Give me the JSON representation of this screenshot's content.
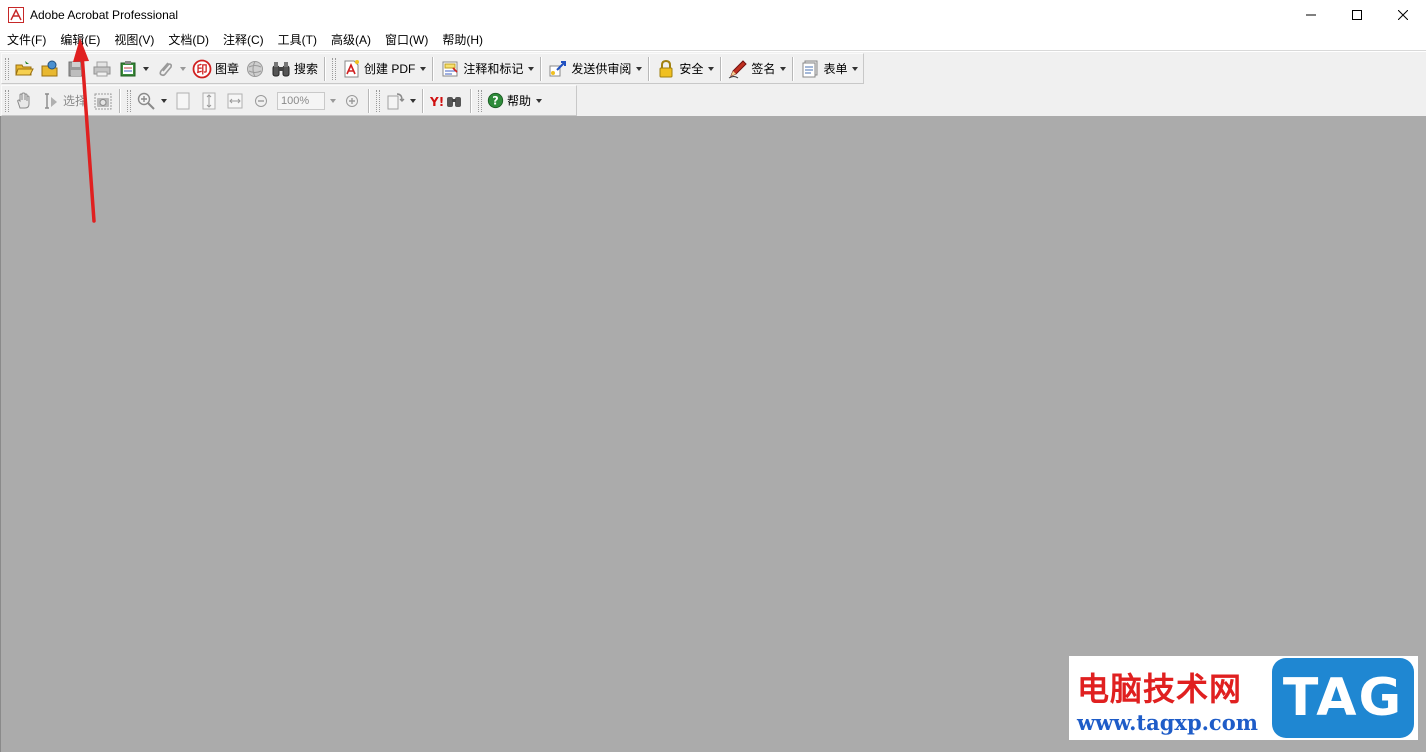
{
  "window": {
    "title": "Adobe Acrobat Professional",
    "controls": [
      "minimize-icon",
      "maximize-icon",
      "close-icon"
    ]
  },
  "menu": {
    "items": [
      "文件(F)",
      "编辑(E)",
      "视图(V)",
      "文档(D)",
      "注释(C)",
      "工具(T)",
      "高级(A)",
      "窗口(W)",
      "帮助(H)"
    ]
  },
  "toolbar1": {
    "stamp_label": "图章",
    "search_label": "搜索",
    "create_pdf_label": "创建 PDF",
    "comment_markup_label": "注释和标记",
    "send_review_label": "发送供审阅",
    "security_label": "安全",
    "sign_label": "签名",
    "forms_label": "表单"
  },
  "toolbar2": {
    "select_label": "选择",
    "zoom_value": "100%",
    "help_label": "帮助"
  },
  "watermark": {
    "title": "电脑技术网",
    "url": "www.tagxp.com",
    "badge": "TAG"
  },
  "colors": {
    "doc_background": "#ababab",
    "annotation_arrow": "#e02020",
    "watermark_red": "#e02020",
    "watermark_blue": "#1f87d2"
  }
}
